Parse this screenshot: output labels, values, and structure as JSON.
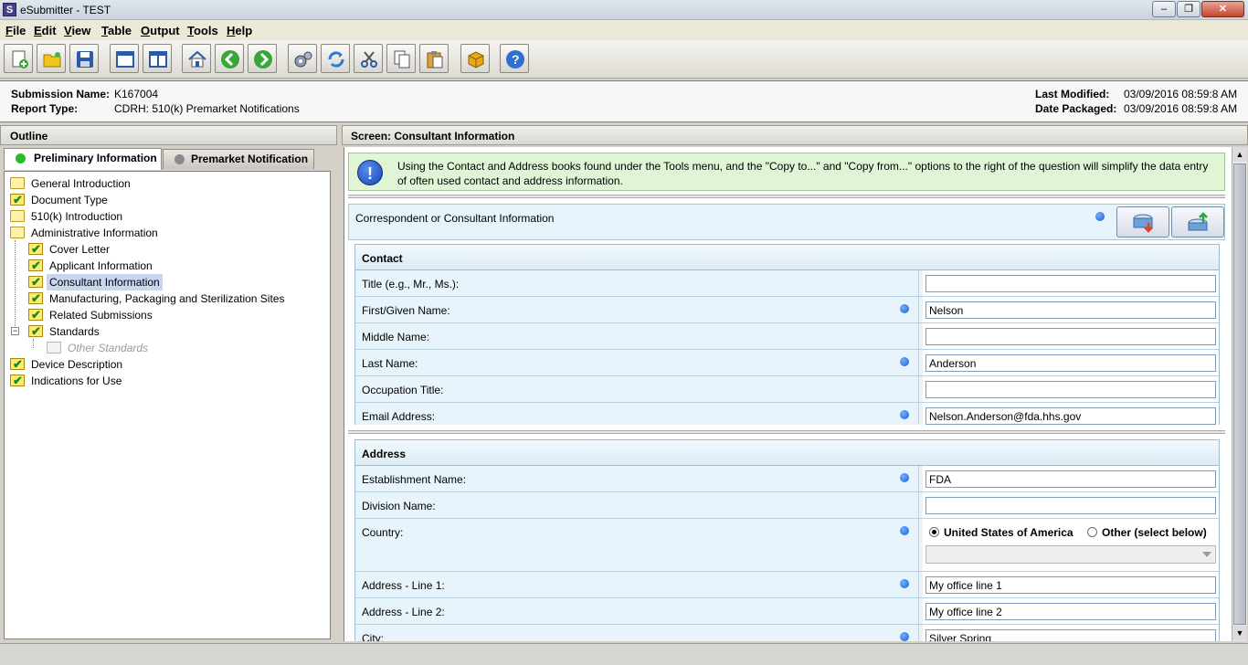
{
  "window": {
    "title": "eSubmitter - TEST",
    "app_icon_letter": "S"
  },
  "menu": [
    {
      "label": "File",
      "u": "F",
      "rest": "ile"
    },
    {
      "label": "Edit",
      "u": "E",
      "rest": "dit"
    },
    {
      "label": "View",
      "u": "V",
      "rest": "iew"
    },
    {
      "label": "Table",
      "u": "T",
      "rest": "able"
    },
    {
      "label": "Output",
      "u": "O",
      "rest": "utput"
    },
    {
      "label": "Tools",
      "u": "T",
      "rest": "ools"
    },
    {
      "label": "Help",
      "u": "H",
      "rest": "elp"
    }
  ],
  "toolbar": {
    "buttons": [
      "new-submission-icon",
      "open-folder-icon",
      "save-icon",
      "window-single-icon",
      "window-split-icon",
      "home-icon",
      "back-arrow-icon",
      "forward-arrow-icon",
      "settings-gears-icon",
      "refresh-icon",
      "cut-icon",
      "copy-icon",
      "paste-icon",
      "package-icon",
      "help-icon"
    ]
  },
  "header": {
    "submission_name_label": "Submission Name:",
    "submission_name": "K167004",
    "report_type_label": "Report Type:",
    "report_type": "CDRH: 510(k) Premarket Notifications",
    "last_modified_label": "Last Modified:",
    "last_modified": "03/09/2016 08:59:8 AM",
    "date_packaged_label": "Date Packaged:",
    "date_packaged": "03/09/2016 08:59:8 AM"
  },
  "outline": {
    "title": "Outline",
    "tabs": [
      {
        "label": "Preliminary Information",
        "status_color": "#2dbb2d"
      },
      {
        "label": "Premarket Notification",
        "status_color": "#8a8a8a"
      }
    ],
    "items": [
      {
        "label": "General Introduction",
        "icon": "folder"
      },
      {
        "label": "Document Type",
        "icon": "check"
      },
      {
        "label": "510(k) Introduction",
        "icon": "folder"
      },
      {
        "label": "Administrative Information",
        "icon": "folder"
      },
      {
        "label": "Cover Letter",
        "icon": "check"
      },
      {
        "label": "Applicant Information",
        "icon": "check"
      },
      {
        "label": "Consultant Information",
        "icon": "check",
        "selected": true
      },
      {
        "label": "Manufacturing, Packaging and Sterilization Sites",
        "icon": "check"
      },
      {
        "label": "Related Submissions",
        "icon": "check"
      },
      {
        "label": "Standards",
        "icon": "check"
      },
      {
        "label": "Other Standards",
        "icon": "folder-empty"
      },
      {
        "label": "Device Description",
        "icon": "check"
      },
      {
        "label": "Indications for Use",
        "icon": "check"
      }
    ]
  },
  "screen": {
    "title": "Screen: Consultant Information",
    "info_message": "Using the Contact and Address books found under the Tools menu, and the \"Copy to...\" and \"Copy from...\" options to the right of the question will simplify the data entry of often used contact and address information.",
    "question_title": "Correspondent or Consultant Information",
    "contact": {
      "heading": "Contact",
      "fields": [
        {
          "label": "Title (e.g., Mr., Ms.):",
          "value": "",
          "required": false
        },
        {
          "label": "First/Given Name:",
          "value": "Nelson",
          "required": true
        },
        {
          "label": "Middle Name:",
          "value": "",
          "required": false
        },
        {
          "label": "Last Name:",
          "value": "Anderson",
          "required": true
        },
        {
          "label": "Occupation Title:",
          "value": "",
          "required": false
        },
        {
          "label": "Email Address:",
          "value": "Nelson.Anderson@fda.hhs.gov",
          "required": true
        }
      ]
    },
    "address": {
      "heading": "Address",
      "establishment_label": "Establishment Name:",
      "establishment_value": "FDA",
      "division_label": "Division Name:",
      "division_value": "",
      "country_label": "Country:",
      "country_option_usa": "United States of America",
      "country_option_other": "Other (select below)",
      "line1_label": "Address - Line 1:",
      "line1_value": "My office line 1",
      "line2_label": "Address - Line 2:",
      "line2_value": "My office line 2",
      "city_label": "City:",
      "city_value": "Silver Spring"
    }
  }
}
